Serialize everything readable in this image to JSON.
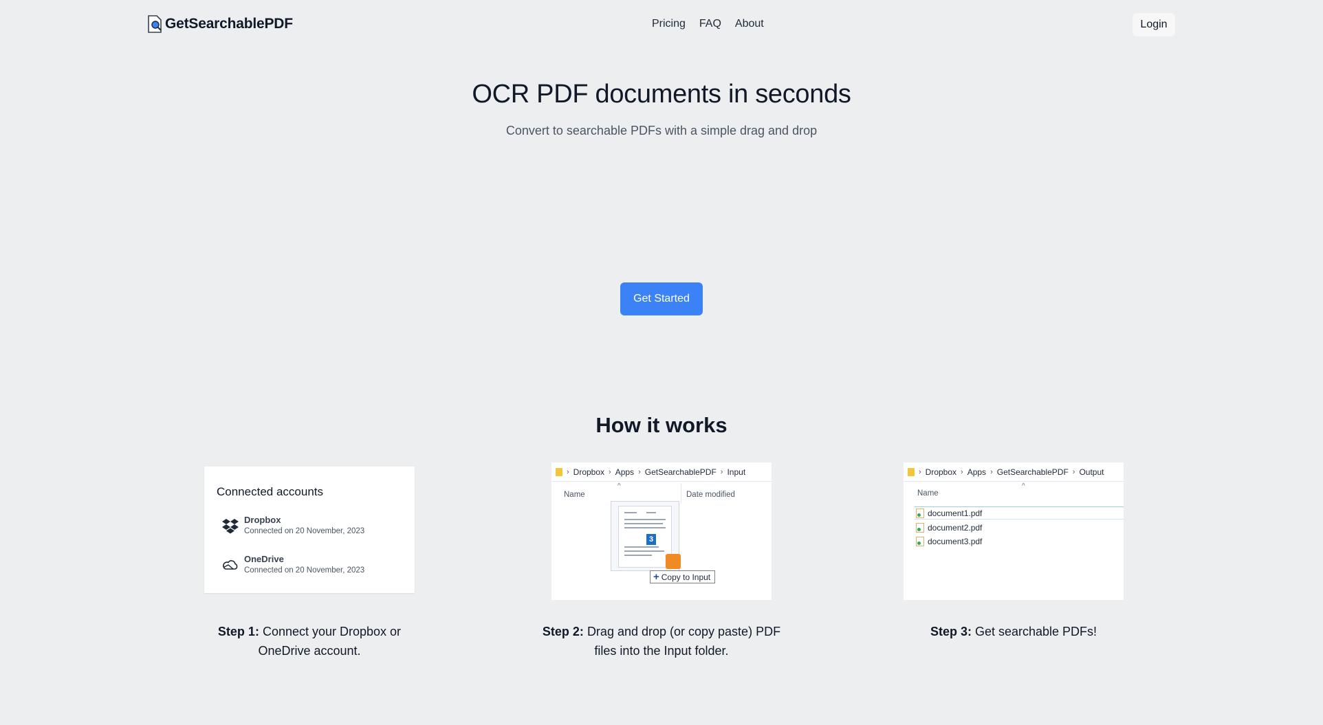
{
  "header": {
    "logo_text": "GetSearchablePDF",
    "nav": [
      "Pricing",
      "FAQ",
      "About"
    ],
    "login_label": "Login"
  },
  "hero": {
    "title": "OCR PDF documents in seconds",
    "subtitle": "Convert to searchable PDFs with a simple drag and drop",
    "cta_label": "Get Started"
  },
  "how": {
    "title": "How it works",
    "step1": {
      "card_title": "Connected accounts",
      "accounts": [
        {
          "name": "Dropbox",
          "connected": "Connected on 20 November, 2023"
        },
        {
          "name": "OneDrive",
          "connected": "Connected on 20 November, 2023"
        }
      ],
      "label": "Step 1:",
      "text": "Connect your Dropbox or OneDrive account."
    },
    "step2": {
      "crumbs": [
        "Dropbox",
        "Apps",
        "GetSearchablePDF",
        "Input"
      ],
      "col_name": "Name",
      "col_date": "Date modified",
      "drag_badge": "3",
      "tooltip": "Copy to Input",
      "label": "Step 2:",
      "text": "Drag and drop (or copy paste) PDF files into the Input folder."
    },
    "step3": {
      "crumbs": [
        "Dropbox",
        "Apps",
        "GetSearchablePDF",
        "Output"
      ],
      "col_name": "Name",
      "files": [
        "document1.pdf",
        "document2.pdf",
        "document3.pdf"
      ],
      "label": "Step 3:",
      "text": "Get searchable PDFs!"
    }
  },
  "colors": {
    "background": "#edeef0",
    "primary": "#3b82f6",
    "text": "#111827"
  }
}
